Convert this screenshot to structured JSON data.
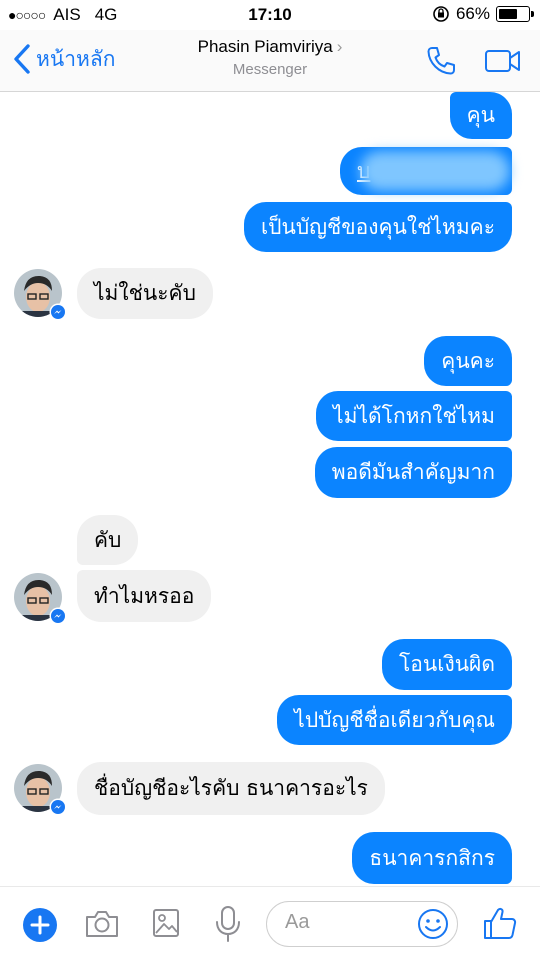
{
  "status_bar": {
    "signal": "●○○○○",
    "carrier": "AIS",
    "network": "4G",
    "time": "17:10",
    "battery_percent": "66%",
    "battery_level": 0.66
  },
  "header": {
    "back_label": "หน้าหลัก",
    "contact_name": "Phasin Piamviriya",
    "subtitle": "Messenger"
  },
  "messages": [
    {
      "from": "me",
      "text": "คุน"
    },
    {
      "from": "me",
      "text": "บ ",
      "redacted": true
    },
    {
      "from": "me",
      "text": "เป็นบัญชีของคุนใช่ไหมคะ"
    },
    {
      "from": "them",
      "text": "ไม่ใช่นะคับ"
    },
    {
      "from": "me",
      "text": "คุนคะ"
    },
    {
      "from": "me",
      "text": "ไม่ได้โกหกใช่ไหม"
    },
    {
      "from": "me",
      "text": "พอดีมันสำคัญมาก"
    },
    {
      "from": "them",
      "text": "คับ"
    },
    {
      "from": "them",
      "text": "ทำไมหรออ"
    },
    {
      "from": "me",
      "text": "โอนเงินผิด"
    },
    {
      "from": "me",
      "text": "ไปบัญชีชื่อเดียวกับคุณ"
    },
    {
      "from": "them",
      "text": "ชื่อบัญชีอะไรคับ ธนาคารอะไร"
    },
    {
      "from": "me",
      "text": "ธนาคารกสิกร"
    }
  ],
  "composer": {
    "placeholder": "Aa"
  },
  "colors": {
    "accent": "#0b84ff",
    "incoming_bubble": "#f0f0f0",
    "ios_blue": "#1877f2"
  }
}
